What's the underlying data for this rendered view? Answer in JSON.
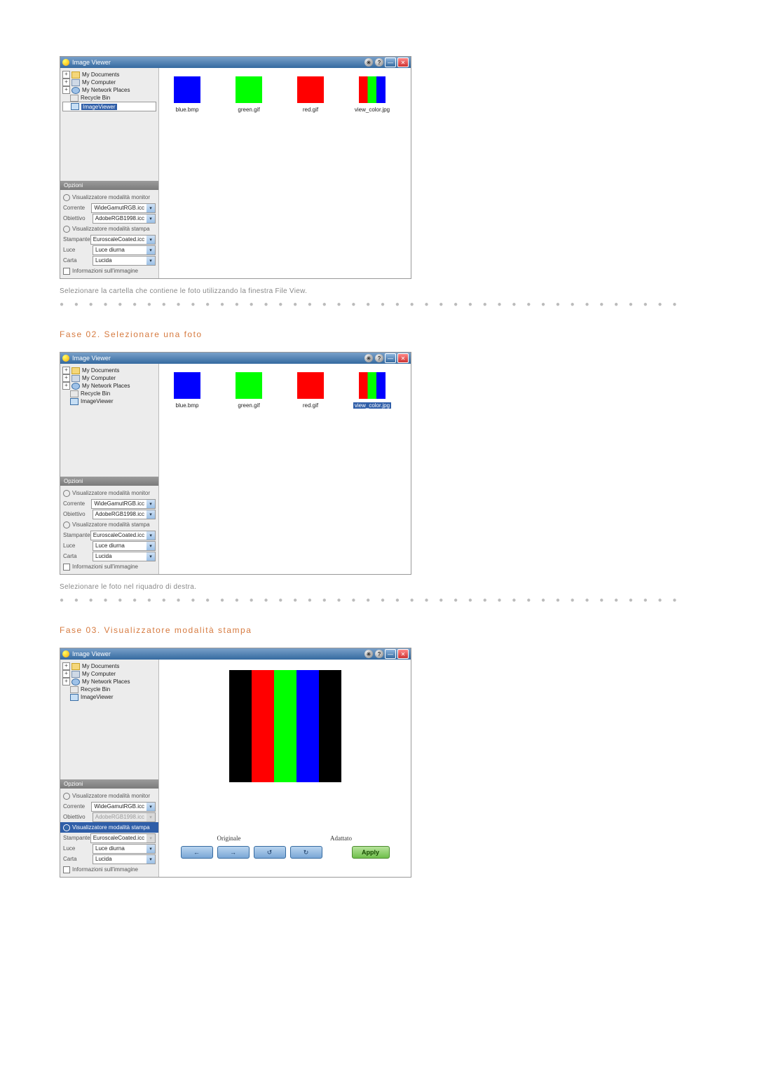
{
  "app_title": "Image Viewer",
  "tree": {
    "my_documents": "My Documents",
    "my_computer": "My Computer",
    "my_network": "My Network Places",
    "recycle_bin": "Recycle Bin",
    "image_viewer": "ImageViewer"
  },
  "options": {
    "header": "Opzioni",
    "monitor_mode": "Visualizzatore modalità monitor",
    "print_mode": "Visualizzatore modalità stampa",
    "current_label": "Corrente",
    "current_value": "WideGamutRGB.icc",
    "target_label": "Obiettivo",
    "target_value": "AdobeRGB1998.icc",
    "printer_label": "Stampante",
    "printer_value": "EuroscaleCoated.icc",
    "light_label": "Luce",
    "light_value": "Luce diurna",
    "paper_label": "Carta",
    "paper_value": "Lucida",
    "info_label": "Informazioni sull'immagine"
  },
  "thumbs": {
    "blue": "blue.bmp",
    "green": "green.gif",
    "red": "red.gif",
    "viewcolor": "view_color.jpg"
  },
  "captions": {
    "c1": "Selezionare la cartella che contiene le foto utilizzando la finestra File View.",
    "c2": "Selezionare le foto nel riquadro di destra."
  },
  "phases": {
    "p2": "Fase 02. Selezionare una foto",
    "p3": "Fase 03. Visualizzatore modalità stampa"
  },
  "preview": {
    "original": "Originale",
    "adapted": "Adattato",
    "apply": "Apply"
  },
  "glyphs": {
    "min": "—",
    "close": "✕",
    "help": "?",
    "left": "←",
    "right": "→",
    "rotl": "↺",
    "rotr": "↻",
    "down": "▾"
  }
}
